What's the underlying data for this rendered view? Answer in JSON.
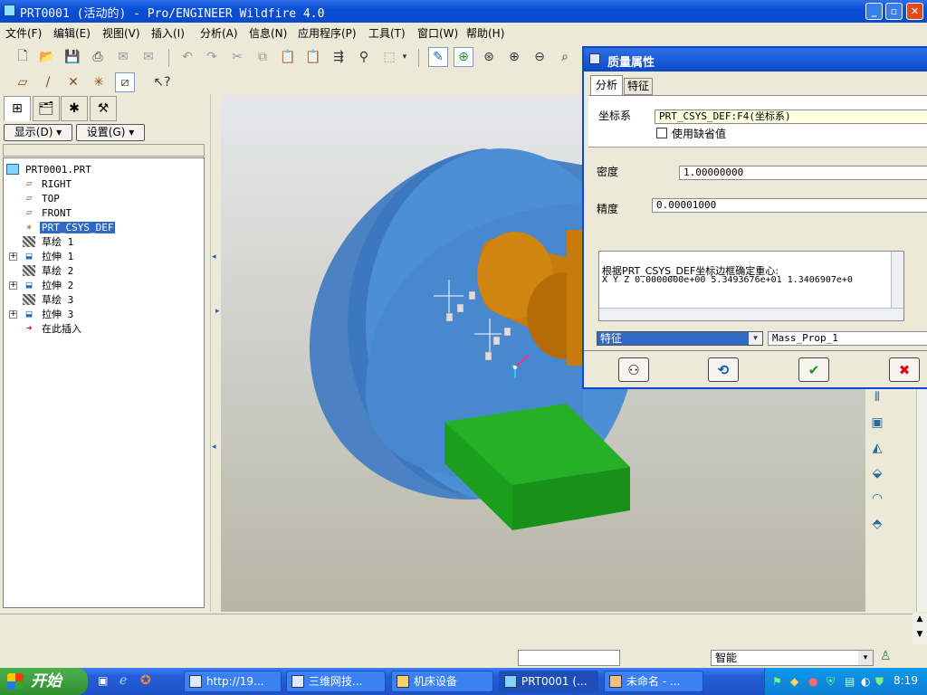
{
  "window": {
    "title": "PRT0001 (活动的) - Pro/ENGINEER Wildfire 4.0",
    "minimize": "_",
    "maximize": "▫",
    "close": "✕"
  },
  "menu": [
    "文件(F)",
    "编辑(E)",
    "视图(V)",
    "插入(I)",
    "分析(A)",
    "信息(N)",
    "应用程序(P)",
    "工具(T)",
    "窗口(W)",
    "帮助(H)"
  ],
  "left_panel": {
    "show_label": "显示(D) ▾",
    "settings_label": "设置(G) ▾",
    "tree": [
      {
        "label": "PRT0001.PRT",
        "icon": "part-icon"
      },
      {
        "label": "RIGHT",
        "icon": "datum-plane-icon"
      },
      {
        "label": "TOP",
        "icon": "datum-plane-icon"
      },
      {
        "label": "FRONT",
        "icon": "datum-plane-icon"
      },
      {
        "label": "PRT_CSYS_DEF",
        "icon": "csys-icon"
      },
      {
        "label": "草绘 1",
        "icon": "sketch-icon"
      },
      {
        "label": "拉伸 1",
        "icon": "extrude-icon"
      },
      {
        "label": "草绘 2",
        "icon": "sketch-icon"
      },
      {
        "label": "拉伸 2",
        "icon": "extrude-icon"
      },
      {
        "label": "草绘 3",
        "icon": "sketch-icon"
      },
      {
        "label": "拉伸 3",
        "icon": "extrude-icon"
      },
      {
        "label": "在此插入",
        "icon": "insert-arrow-icon"
      }
    ]
  },
  "dialog": {
    "title": "质量属性",
    "tabs": [
      "分析",
      "特征"
    ],
    "csys_label": "坐标系",
    "csys_value": "PRT_CSYS_DEF:F4(坐标系)",
    "use_default_label": "使用缺省值",
    "density_label": "密度",
    "density_value": "1.00000000",
    "precision_label": "精度",
    "precision_value": "0.00001000",
    "result_line1": "根据PRT_CSYS_DEF坐标边框确定重心:",
    "result_line2": "X   Y   Z  0.0000000e+00  5.3493676e+01  1.3406907e+0",
    "feature_select": "特征",
    "feature_name": "Mass_Prop_1"
  },
  "status": {
    "filter_value": "智能"
  },
  "taskbar": {
    "start": "开始",
    "tasks": [
      "http://19...",
      "三维网技...",
      "机床设备",
      "PRT0001 (...",
      "未命名 - ..."
    ],
    "clock": "8:19"
  },
  "colors": {
    "titlebar": "#0b4fd6",
    "cylinder_blue": "#4a8ad0",
    "boss_orange": "#c97a0a",
    "block_green": "#1f9a1f"
  }
}
